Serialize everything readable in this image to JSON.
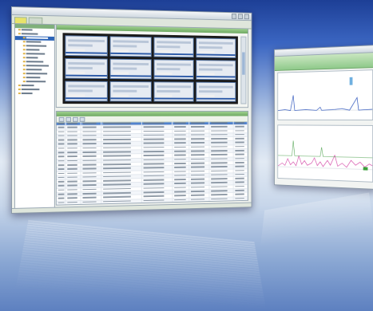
{
  "colors": {
    "accent_green": "#7fb07a",
    "tab_active": "#e8e36a",
    "list_header": "#2f62b4",
    "selection": "#2c64b8",
    "chart_line_blue": "#3a5fc0",
    "chart_line_pink": "#d44aa8"
  },
  "main_window": {
    "tabs": [
      {
        "id": "tab-1"
      },
      {
        "id": "tab-2"
      }
    ],
    "tree_items": [
      {
        "level": 0,
        "selected": false
      },
      {
        "level": 0,
        "selected": false
      },
      {
        "level": 1,
        "selected": true
      },
      {
        "level": 1,
        "selected": false
      },
      {
        "level": 1,
        "selected": false
      },
      {
        "level": 1,
        "selected": false
      },
      {
        "level": 1,
        "selected": false
      },
      {
        "level": 1,
        "selected": false
      },
      {
        "level": 1,
        "selected": false
      },
      {
        "level": 1,
        "selected": false
      },
      {
        "level": 1,
        "selected": false
      },
      {
        "level": 1,
        "selected": false
      },
      {
        "level": 1,
        "selected": false
      },
      {
        "level": 1,
        "selected": false
      },
      {
        "level": 0,
        "selected": false
      },
      {
        "level": 0,
        "selected": false
      },
      {
        "level": 0,
        "selected": false
      }
    ],
    "device_tiles": 12,
    "list_columns": 9,
    "list_rows": 24
  },
  "icons": [
    "folder-icon",
    "minimize-icon",
    "maximize-icon",
    "close-icon"
  ]
}
